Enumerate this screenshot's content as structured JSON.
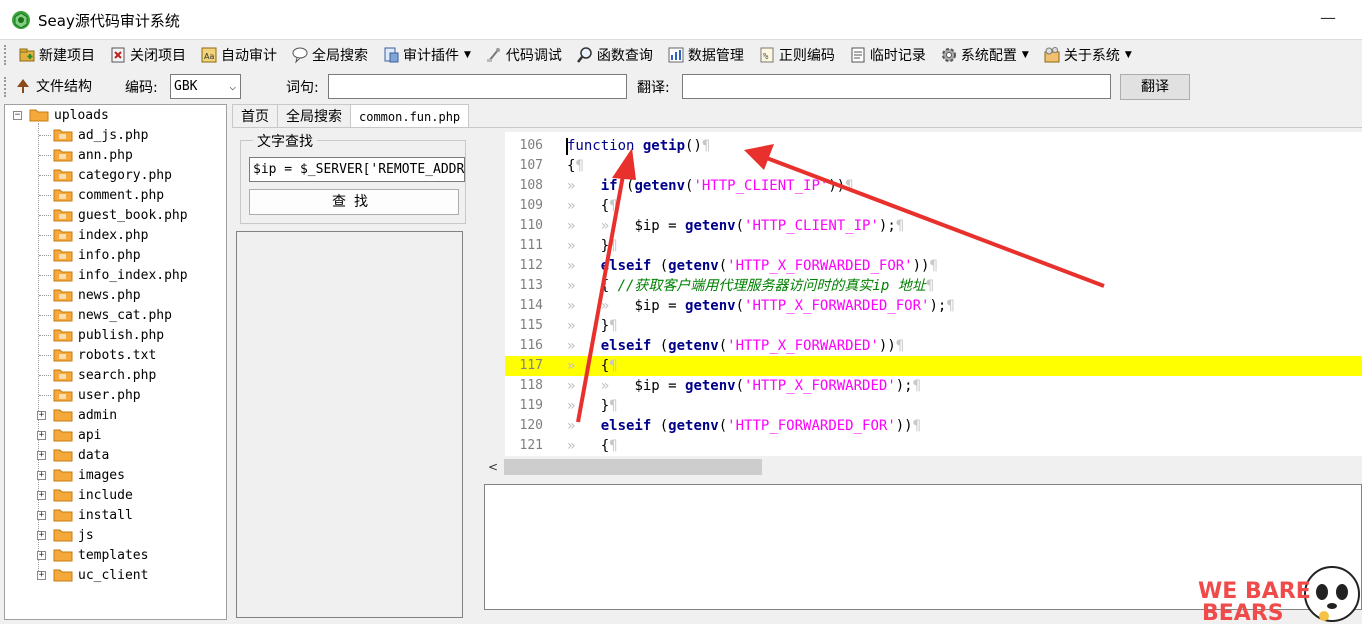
{
  "app": {
    "title": "Seay源代码审计系统"
  },
  "toolbar": {
    "items": [
      {
        "label": "新建项目",
        "icon": "new-project-icon"
      },
      {
        "label": "关闭项目",
        "icon": "close-project-icon"
      },
      {
        "label": "自动审计",
        "icon": "auto-audit-icon"
      },
      {
        "label": "全局搜索",
        "icon": "global-search-icon"
      },
      {
        "label": "审计插件",
        "icon": "plugin-icon",
        "dropdown": true
      },
      {
        "label": "代码调试",
        "icon": "debug-icon"
      },
      {
        "label": "函数查询",
        "icon": "function-query-icon"
      },
      {
        "label": "数据管理",
        "icon": "data-manage-icon"
      },
      {
        "label": "正则编码",
        "icon": "regex-icon"
      },
      {
        "label": "临时记录",
        "icon": "temp-record-icon"
      },
      {
        "label": "系统配置",
        "icon": "gear-icon",
        "dropdown": true
      },
      {
        "label": "关于系统",
        "icon": "about-icon",
        "dropdown": true
      }
    ]
  },
  "bar2": {
    "tree_toggle": "文件结构",
    "encoding_label": "编码:",
    "encoding_value": "GBK",
    "word_label": "词句:",
    "word_value": "",
    "translate_label": "翻译:",
    "translate_value": "",
    "translate_button": "翻译"
  },
  "tree": {
    "root": "uploads",
    "files": [
      "ad_js.php",
      "ann.php",
      "category.php",
      "comment.php",
      "guest_book.php",
      "index.php",
      "info.php",
      "info_index.php",
      "news.php",
      "news_cat.php",
      "publish.php",
      "robots.txt",
      "search.php",
      "user.php"
    ],
    "folders": [
      "admin",
      "api",
      "data",
      "images",
      "include",
      "install",
      "js",
      "templates",
      "uc_client"
    ]
  },
  "tabs": [
    "首页",
    "全局搜索",
    "common.fun.php"
  ],
  "find": {
    "title": "文字查找",
    "query": "$ip = $_SERVER['REMOTE_ADDR'",
    "button": "查找"
  },
  "editor": {
    "highlight_line": 117,
    "lines": [
      {
        "n": "106",
        "t": "function getip()"
      },
      {
        "n": "107",
        "t": "{"
      },
      {
        "n": "108",
        "t": "if (getenv('HTTP_CLIENT_IP'))"
      },
      {
        "n": "109",
        "t": "{"
      },
      {
        "n": "110",
        "t": "$ip = getenv('HTTP_CLIENT_IP');"
      },
      {
        "n": "111",
        "t": "}"
      },
      {
        "n": "112",
        "t": "elseif (getenv('HTTP_X_FORWARDED_FOR'))"
      },
      {
        "n": "113",
        "t": "{ //获取客户端用代理服务器访问时的真实ip 地址"
      },
      {
        "n": "114",
        "t": "$ip = getenv('HTTP_X_FORWARDED_FOR');"
      },
      {
        "n": "115",
        "t": "}"
      },
      {
        "n": "116",
        "t": "elseif (getenv('HTTP_X_FORWARDED'))"
      },
      {
        "n": "117",
        "t": "{"
      },
      {
        "n": "118",
        "t": "$ip = getenv('HTTP_X_FORWARDED');"
      },
      {
        "n": "119",
        "t": "}"
      },
      {
        "n": "120",
        "t": "elseif (getenv('HTTP_FORWARDED_FOR'))"
      },
      {
        "n": "121",
        "t": "{"
      }
    ]
  },
  "watermark": {
    "text": "WE BARE BEARS"
  },
  "colors": {
    "highlight": "#ffff00",
    "keyword": "#00008b",
    "string": "#ff00ff",
    "comment": "#008000",
    "arrow": "#e8312c"
  }
}
